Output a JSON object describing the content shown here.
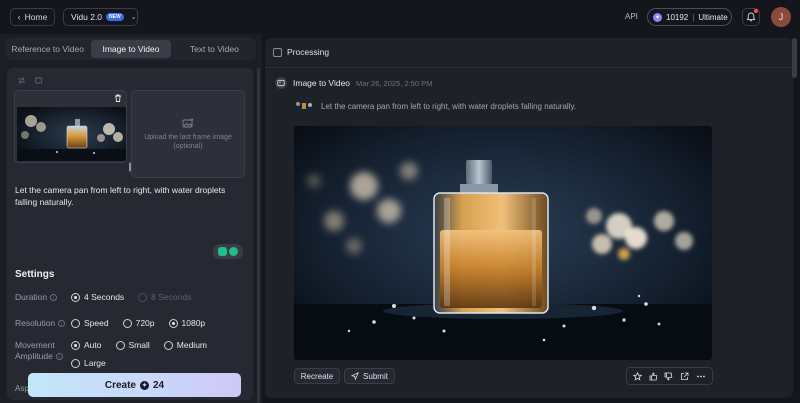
{
  "header": {
    "home_label": "Home",
    "model_label": "Vidu 2.0",
    "model_badge": "NEW",
    "api_label": "API",
    "credits_value": "10192",
    "plan_label": "Ultimate",
    "avatar_initial": "J"
  },
  "left": {
    "tabs": [
      {
        "label": "Reference to Video",
        "active": false
      },
      {
        "label": "Image to Video",
        "active": true
      },
      {
        "label": "Text to Video",
        "active": false
      }
    ],
    "last_frame_placeholder": "Upload the last frame image (optional)",
    "prompt_text": "Let the camera pan from left to right, with water droplets falling naturally.",
    "settings": {
      "title": "Settings",
      "duration_label": "Duration",
      "duration_options": [
        "4 Seconds",
        "8 Seconds"
      ],
      "duration_selected": "4 Seconds",
      "resolution_label": "Resolution",
      "resolution_options": [
        "Speed",
        "720p",
        "1080p"
      ],
      "resolution_selected": "1080p",
      "movement_label_1": "Movement",
      "movement_label_2": "Amplitude",
      "movement_options": [
        "Auto",
        "Small",
        "Medium",
        "Large"
      ],
      "movement_selected": "Auto",
      "partial_label": "Aspe"
    },
    "create_label": "Create",
    "create_cost": "24"
  },
  "right": {
    "processing_label": "Processing",
    "task_title": "Image to Video",
    "task_time": "Mar 26, 2025, 2:50 PM",
    "task_prompt": "Let the camera pan from left to right, with water droplets falling naturally.",
    "recreate_label": "Recreate",
    "submit_label": "Submit"
  },
  "colors": {
    "background": "#14161c",
    "panel": "#1e2128",
    "accent": "#3b6cf0",
    "create_gradient_start": "#c3e6f8",
    "create_gradient_end": "#cfc8f6",
    "enhance_green": "#1fbf8a"
  }
}
